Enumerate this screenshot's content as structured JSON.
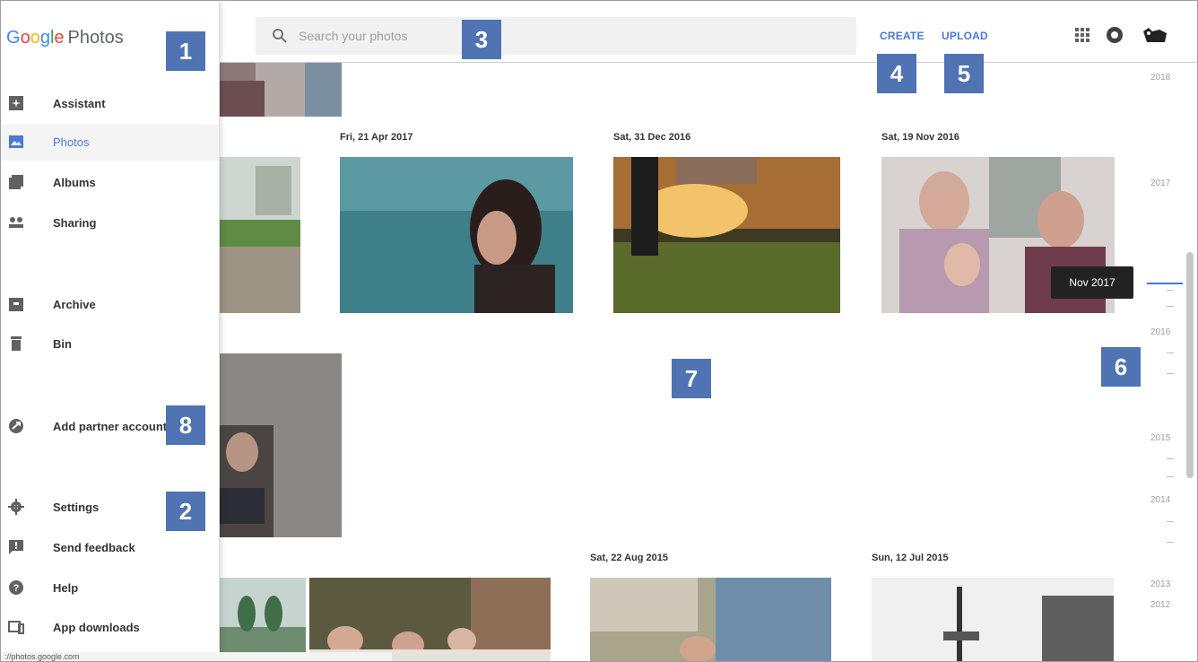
{
  "app": {
    "logo_letters": [
      "G",
      "o",
      "o",
      "g",
      "l",
      "e"
    ],
    "logo_product": "Photos"
  },
  "header": {
    "search_placeholder": "Search your photos",
    "create_label": "CREATE",
    "upload_label": "UPLOAD",
    "icons": [
      "apps-grid-icon",
      "notifications-icon",
      "account-avatar-icon"
    ]
  },
  "sidebar": {
    "items": [
      {
        "label": "Assistant",
        "icon": "assistant-icon"
      },
      {
        "label": "Photos",
        "icon": "photos-icon",
        "active": true
      },
      {
        "label": "Albums",
        "icon": "albums-icon"
      },
      {
        "label": "Sharing",
        "icon": "sharing-icon"
      },
      {
        "label": "Archive",
        "icon": "archive-icon"
      },
      {
        "label": "Bin",
        "icon": "bin-icon"
      },
      {
        "label": "Add partner account",
        "icon": "partner-account-icon"
      },
      {
        "label": "Settings",
        "icon": "settings-icon"
      },
      {
        "label": "Send feedback",
        "icon": "feedback-icon"
      },
      {
        "label": "Help",
        "icon": "help-icon"
      },
      {
        "label": "App downloads",
        "icon": "app-downloads-icon"
      }
    ]
  },
  "groups": {
    "date_1": "Fri, 21 Apr 2017",
    "date_2": "Sat, 31 Dec 2016",
    "date_3": "Sat, 19 Nov 2016",
    "date_4": "Sat, 22 Aug 2015",
    "date_5": "Sun, 12 Jul 2015"
  },
  "timeline": {
    "years": [
      "2018",
      "2017",
      "2016",
      "2015",
      "2014",
      "2013",
      "2012"
    ],
    "tooltip": "Nov 2017"
  },
  "badges": [
    "1",
    "2",
    "3",
    "4",
    "5",
    "6",
    "7",
    "8"
  ],
  "status_url": "://photos.google.com",
  "colors": {
    "accent": "#4a79d6",
    "badge": "#4f73b3"
  }
}
